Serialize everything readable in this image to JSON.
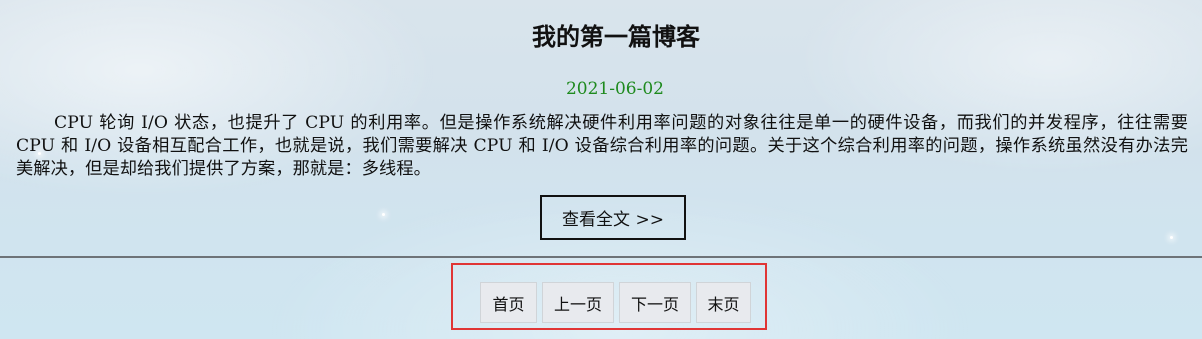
{
  "post": {
    "title": "我的第一篇博客",
    "date": "2021-06-02",
    "excerpt": "CPU 轮询 I/O 状态，也提升了 CPU 的利用率。但是操作系统解决硬件利用率问题的对象往往是单一的硬件设备，而我们的并发程序，往往需要 CPU 和 I/O 设备相互配合工作，也就是说，我们需要解决 CPU 和 I/O 设备综合利用率的问题。关于这个综合利用率的问题，操作系统虽然没有办法完美解决，但是却给我们提供了方案，那就是：多线程。",
    "read_more_label": "查看全文 >>"
  },
  "pagination": {
    "first_label": "首页",
    "prev_label": "上一页",
    "next_label": "下一页",
    "last_label": "末页"
  },
  "colors": {
    "date": "#1e8a1e",
    "pagination_outline": "#e03535"
  }
}
